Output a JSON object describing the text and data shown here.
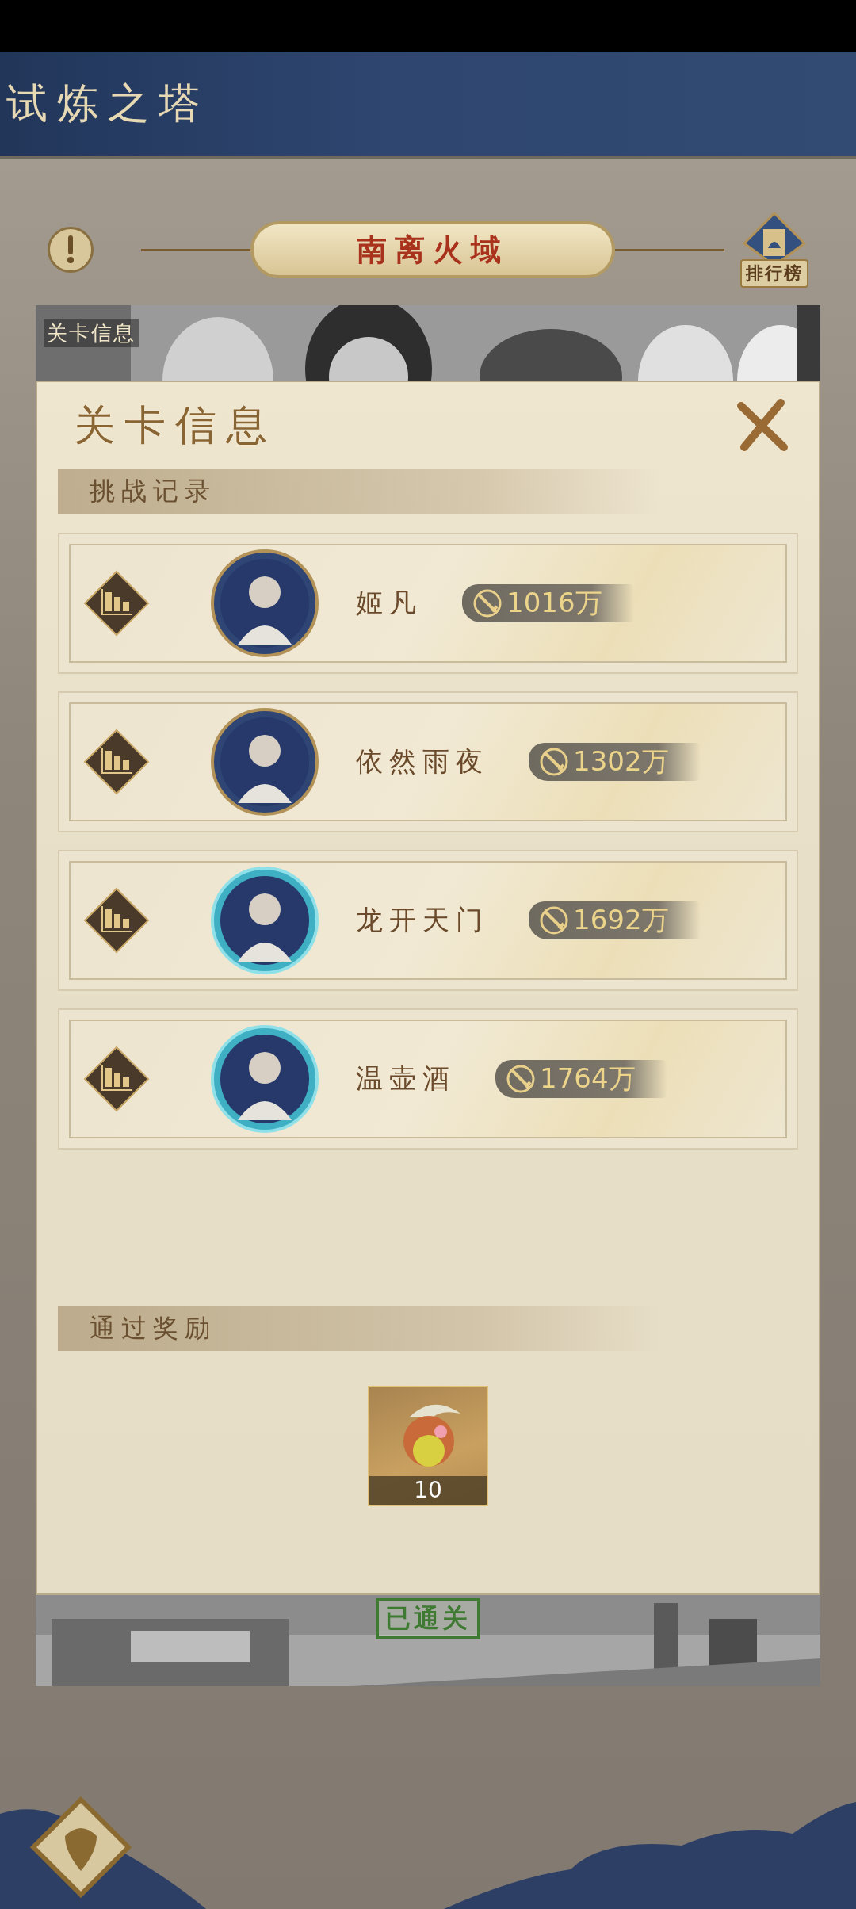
{
  "header": {
    "title": "试炼之塔"
  },
  "region": {
    "title": "南离火域",
    "leaderboard_label": "排行榜"
  },
  "stage_banner": {
    "label": "关卡信息"
  },
  "dialog": {
    "title": "关卡信息",
    "record_heading": "挑战记录",
    "records": [
      {
        "name": "姬凡",
        "power": "1016万",
        "kind": "gold"
      },
      {
        "name": "依然雨夜",
        "power": "1302万",
        "kind": "gold"
      },
      {
        "name": "龙开天门",
        "power": "1692万",
        "kind": "jade"
      },
      {
        "name": "温壶酒",
        "power": "1764万",
        "kind": "jade"
      }
    ],
    "reward_heading": "通过奖励",
    "rewards": [
      {
        "count": "10"
      }
    ]
  },
  "stage_status": "已通关"
}
